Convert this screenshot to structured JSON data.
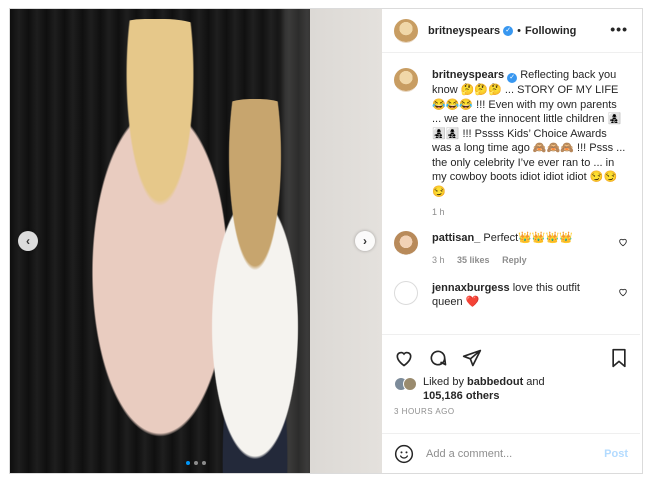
{
  "header": {
    "username": "britneyspears",
    "separator": "•",
    "follow_status": "Following",
    "more": "•••"
  },
  "photo": {
    "prev": "‹",
    "next": "›",
    "slides": 3,
    "active_slide": 1
  },
  "caption": {
    "username": "britneyspears",
    "text": "Reflecting back you know 🤔🤔🤔 ... STORY OF MY LIFE 😂😂😂 !!! Even with my own parents ... we are the innocent little children 👩‍👧‍👦👩‍👧‍👦👩‍👧‍👦 !!! Pssss Kids’ Choice Awards was a long time ago 🙈🙈🙈 !!! Psss ... the only celebrity I’ve ever ran to ... in my cowboy boots idiot idiot idiot 😏😏😏",
    "time": "1 h"
  },
  "comments": [
    {
      "username": "pattisan_",
      "text": "Perfect👑👑👑👑",
      "time": "3 h",
      "likes": "35 likes",
      "reply": "Reply"
    },
    {
      "username": "jennaxburgess",
      "text": "love this outfit queen ❤️"
    }
  ],
  "likes": {
    "prefix": "Liked by ",
    "user": "babbedout",
    "middle": " and",
    "count": "105,186 others"
  },
  "posted": "3 HOURS AGO",
  "add_comment": {
    "placeholder": "Add a comment...",
    "post_label": "Post"
  },
  "icons": {
    "like": "heart-icon",
    "comment": "comment-icon",
    "share": "share-icon",
    "save": "bookmark-icon",
    "emoji": "emoji-icon"
  }
}
